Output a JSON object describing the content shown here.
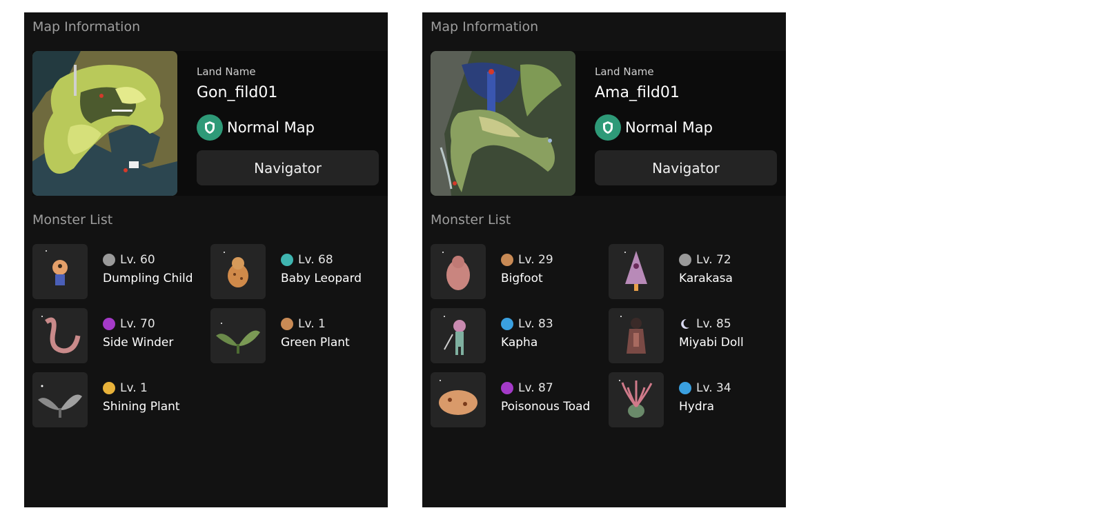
{
  "panels": [
    {
      "map_section_title": "Map Information",
      "land_label": "Land Name",
      "land_name": "Gon_fild01",
      "map_type": "Normal Map",
      "navigator_label": "Navigator",
      "monster_section_title": "Monster List",
      "monsters": [
        {
          "level": "Lv. 60",
          "name": "Dumpling Child",
          "element": "neutral",
          "element_color": "#9a9a9a",
          "sprite": "dumpling-child-sprite"
        },
        {
          "level": "Lv. 68",
          "name": "Baby Leopard",
          "element": "wind",
          "element_color": "#3fb5b0",
          "sprite": "baby-leopard-sprite"
        },
        {
          "level": "Lv. 70",
          "name": "Side Winder",
          "element": "poison",
          "element_color": "#a43ac8",
          "sprite": "side-winder-sprite"
        },
        {
          "level": "Lv. 1",
          "name": "Green Plant",
          "element": "earth",
          "element_color": "#c88a55",
          "sprite": "green-plant-sprite"
        },
        {
          "level": "Lv. 1",
          "name": "Shining Plant",
          "element": "holy",
          "element_color": "#e8b23a",
          "sprite": "shining-plant-sprite"
        }
      ]
    },
    {
      "map_section_title": "Map Information",
      "land_label": "Land Name",
      "land_name": "Ama_fild01",
      "map_type": "Normal Map",
      "navigator_label": "Navigator",
      "monster_section_title": "Monster List",
      "monsters": [
        {
          "level": "Lv. 29",
          "name": "Bigfoot",
          "element": "earth",
          "element_color": "#c88a55",
          "sprite": "bigfoot-sprite"
        },
        {
          "level": "Lv. 72",
          "name": "Karakasa",
          "element": "neutral",
          "element_color": "#9a9a9a",
          "sprite": "karakasa-sprite"
        },
        {
          "level": "Lv. 83",
          "name": "Kapha",
          "element": "water",
          "element_color": "#3aa0e0",
          "sprite": "kapha-sprite"
        },
        {
          "level": "Lv. 85",
          "name": "Miyabi Doll",
          "element": "shadow",
          "element_color": "#d8d8f0",
          "sprite": "miyabi-doll-sprite"
        },
        {
          "level": "Lv. 87",
          "name": "Poisonous Toad",
          "element": "poison",
          "element_color": "#a43ac8",
          "sprite": "poisonous-toad-sprite"
        },
        {
          "level": "Lv. 34",
          "name": "Hydra",
          "element": "water",
          "element_color": "#3aa0e0",
          "sprite": "hydra-sprite"
        }
      ]
    }
  ],
  "colors": {
    "panel_bg": "#121212",
    "map_type_badge": "#2e9a78",
    "button_bg": "#242424"
  }
}
